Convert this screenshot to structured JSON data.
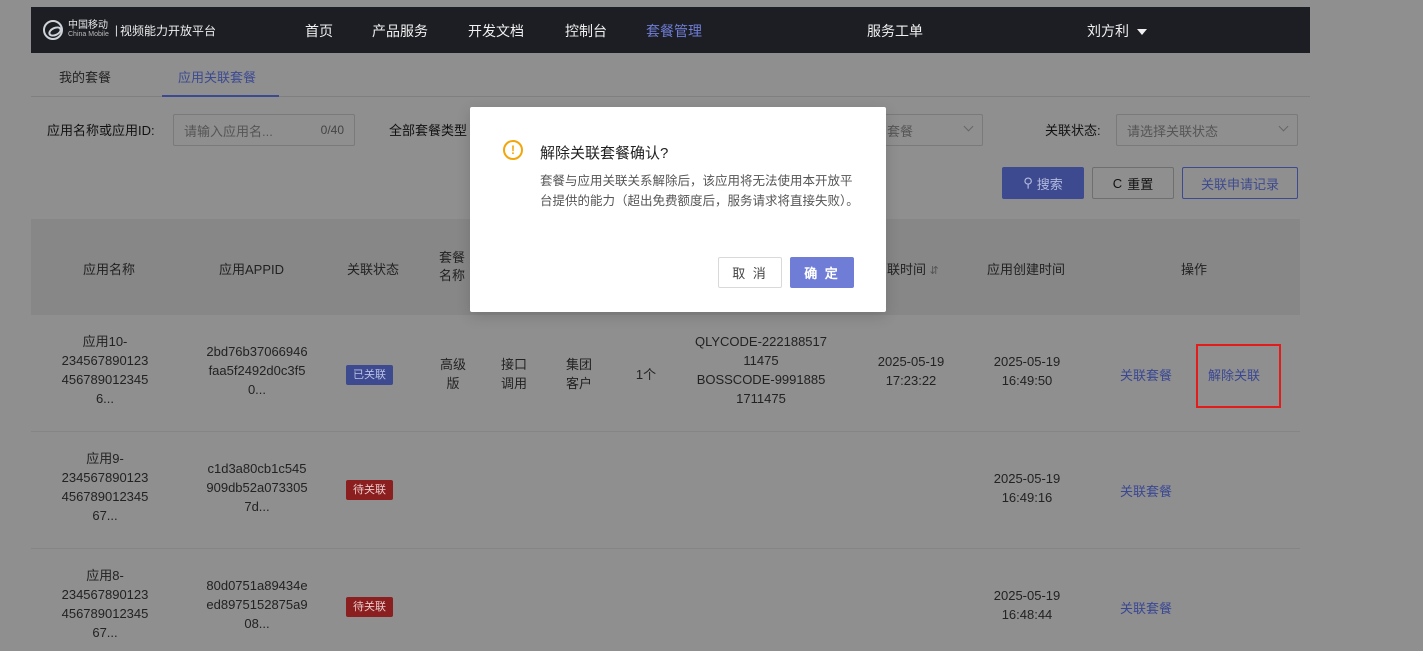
{
  "header": {
    "logo_cn": "中国移动",
    "logo_en": "China Mobile",
    "separator": "|",
    "platform": "视频能力开放平台",
    "nav": [
      {
        "label": "首页"
      },
      {
        "label": "产品服务"
      },
      {
        "label": "开发文档"
      },
      {
        "label": "控制台"
      },
      {
        "label": "套餐管理"
      },
      {
        "label": "服务工单"
      }
    ],
    "active_nav": "套餐管理",
    "user": "刘方利"
  },
  "tabs": [
    {
      "label": "我的套餐"
    },
    {
      "label": "应用关联套餐"
    }
  ],
  "active_tab": "应用关联套餐",
  "filters": {
    "app_label": "应用名称或应用ID:",
    "app_placeholder": "请输入应用名...",
    "app_count": "0/40",
    "type_label": "全部套餐类型",
    "package_placeholder": "套餐",
    "status_label": "关联状态:",
    "status_placeholder": "请选择关联状态"
  },
  "buttons": {
    "search": "搜索",
    "reset": "重置",
    "log": "关联申请记录"
  },
  "table": {
    "headers": {
      "app_name": "应用名称",
      "appid": "应用APPID",
      "status": "关联状态",
      "package_name": "套餐名称",
      "link_time": "联时间",
      "create_time": "应用创建时间",
      "actions": "操作"
    },
    "rows": [
      {
        "name": "应用10-234567890123456789012345 6...",
        "name_lines": [
          "应用10-",
          "234567890123",
          "456789012345",
          "6..."
        ],
        "appid_lines": [
          "2bd76b37066946",
          "faa5f2492d0c3f5",
          "0..."
        ],
        "status": "已关联",
        "status_type": "linked",
        "package": [
          "高级",
          "版"
        ],
        "usage": [
          "接口",
          "调用"
        ],
        "customer": [
          "集团",
          "客户"
        ],
        "quantity": "1个",
        "codes": [
          "QLYCODE-222188517",
          "11475",
          "BOSSCODE-9991885",
          "1711475"
        ],
        "link_time": [
          "2025-05-19",
          "17:23:22"
        ],
        "create_time": [
          "2025-05-19",
          "16:49:50"
        ],
        "action_link": "关联套餐",
        "action_unlink": "解除关联"
      },
      {
        "name_lines": [
          "应用9-",
          "234567890123",
          "456789012345",
          "67..."
        ],
        "appid_lines": [
          "c1d3a80cb1c545",
          "909db52a073305",
          "7d..."
        ],
        "status": "待关联",
        "status_type": "pending",
        "create_time": [
          "2025-05-19",
          "16:49:16"
        ],
        "action_link": "关联套餐"
      },
      {
        "name_lines": [
          "应用8-",
          "234567890123",
          "456789012345",
          "67..."
        ],
        "appid_lines": [
          "80d0751a89434e",
          "ed8975152875a9",
          "08..."
        ],
        "status": "待关联",
        "status_type": "pending",
        "create_time": [
          "2025-05-19",
          "16:48:44"
        ],
        "action_link": "关联套餐"
      }
    ]
  },
  "dialog": {
    "icon": "!",
    "title": "解除关联套餐确认?",
    "body": "套餐与应用关联关系解除后，该应用将无法使用本开放平台提供的能力（超出免费额度后，服务请求将直接失败）。",
    "cancel": "取 消",
    "confirm": "确 定"
  },
  "colors": {
    "accent": "#6f7dd6",
    "topbar": "#1c1e23",
    "pending": "#8b1f1f",
    "highlight": "#e31b1b",
    "warning": "#f2a60c"
  }
}
